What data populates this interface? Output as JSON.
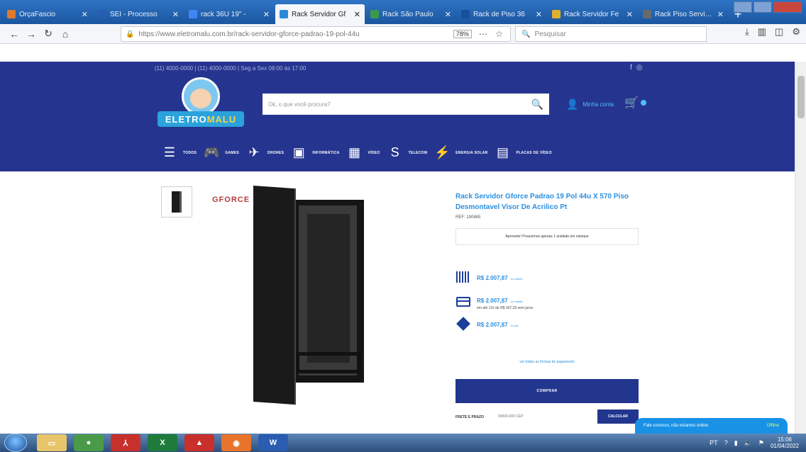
{
  "browser": {
    "tabs": [
      {
        "title": "OrçaFascio",
        "color": "#e07a2c",
        "active": false
      },
      {
        "title": "SEI - Processo",
        "color": "#2a5db0",
        "active": false
      },
      {
        "title": "rack 36U 19\" -",
        "color": "#4285f4",
        "active": false
      },
      {
        "title": "Rack Servidor Gf",
        "color": "#2a8ad8",
        "active": true
      },
      {
        "title": "Rack São Paulo",
        "color": "#3a9a4a",
        "active": false
      },
      {
        "title": "Rack de Piso 36",
        "color": "#1a4f9c",
        "active": false
      },
      {
        "title": "Rack Servidor Fe",
        "color": "#e0b02c",
        "active": false
      },
      {
        "title": "Rack Piso Servidor",
        "color": "#6a6a6a",
        "active": false
      }
    ],
    "url": "https://www.eletromalu.com.br/rack-servidor-gforce-padrao-19-pol-44u",
    "zoom": "78%",
    "search_placeholder": "Pesquisar"
  },
  "site": {
    "topline": "(11) 4000-0000 | (11) 4000-0000 | Seg a Sex 08:00 às 17:00",
    "logo_text_a": "ELETRO",
    "logo_text_b": "MALU",
    "search_placeholder": "Ok, o que você procura?",
    "account_label": "Minha conta",
    "menu": [
      {
        "icon": "menu-icon",
        "glyph": "☰",
        "label": "TODOS"
      },
      {
        "icon": "gamepad-icon",
        "glyph": "🎮",
        "label": "GAMES"
      },
      {
        "icon": "drone-icon",
        "glyph": "✈",
        "label": "DRONES"
      },
      {
        "icon": "chip-icon",
        "glyph": "▣",
        "label": "INFORMÁTICA"
      },
      {
        "icon": "film-icon",
        "glyph": "▦",
        "label": "VÍDEO"
      },
      {
        "icon": "telecom-icon",
        "glyph": "S",
        "label": "TELECOM"
      },
      {
        "icon": "bolt-icon",
        "glyph": "⚡",
        "label": "ENERGIA SOLAR"
      },
      {
        "icon": "card-icon",
        "glyph": "▤",
        "label": "PLACAS DE VÍDEO"
      }
    ]
  },
  "product": {
    "brand": "GFORCE",
    "title": "Rack Servidor Gforce Padrao 19 Pol 44u X 570 Piso Desmontavel Visor De Acrilico Pt",
    "sku": "REF: 190865",
    "stock": "Aproveite! Possuímos apenas 1 unidade em estoque",
    "prices": [
      {
        "icon": "barcode-icon",
        "value": "R$ 2.007,87",
        "note": "no boleto",
        "sub": ""
      },
      {
        "icon": "credit-card-icon",
        "value": "R$ 2.007,87",
        "note": "no cartão",
        "sub": "em até 12x de R$ 167,33 sem juros"
      },
      {
        "icon": "pix-icon",
        "value": "R$ 2.007,87",
        "note": "no pix",
        "sub": ""
      }
    ],
    "installments_link": "ver todas as formas de pagamento",
    "buy_label": "COMPRAR",
    "freight_label": "FRETE E PRAZO",
    "cep_placeholder": "00000-000 CEP",
    "calc_label": "CALCULAR"
  },
  "chat": {
    "text": "Fale conosco, não estamos online",
    "status": "Offline"
  },
  "taskbar": {
    "apps": [
      {
        "icon": "explorer-icon",
        "color": "#e8c56a",
        "glyph": "▭"
      },
      {
        "icon": "chrome-icon",
        "color": "#4a9a4a",
        "glyph": "●"
      },
      {
        "icon": "acrobat-icon",
        "color": "#c8302c",
        "glyph": "⅄"
      },
      {
        "icon": "excel-icon",
        "color": "#1e7b3c",
        "glyph": "X"
      },
      {
        "icon": "autocad-icon",
        "color": "#c8302c",
        "glyph": "▲"
      },
      {
        "icon": "firefox-icon",
        "color": "#e8742c",
        "glyph": "◉"
      },
      {
        "icon": "word-icon",
        "color": "#2a5db0",
        "glyph": "W"
      }
    ],
    "lang": "PT",
    "time": "15:06",
    "date": "01/04/2022"
  }
}
